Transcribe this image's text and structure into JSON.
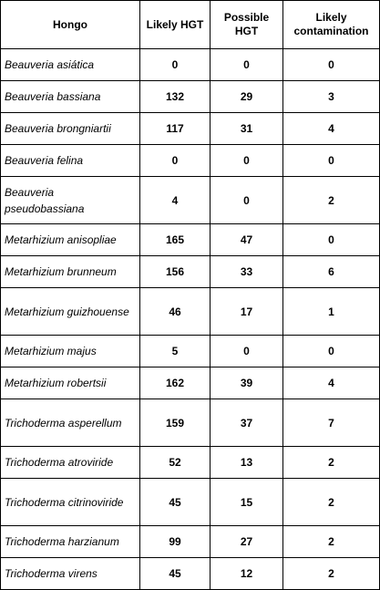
{
  "table": {
    "headers": [
      "Hongo",
      "Likely HGT",
      "Possible HGT",
      "Likely contamination"
    ],
    "rows": [
      {
        "name": "Beauveria asiática",
        "likely": "0",
        "possible": "0",
        "contamination": "0"
      },
      {
        "name": "Beauveria bassiana",
        "likely": "132",
        "possible": "29",
        "contamination": "3"
      },
      {
        "name": "Beauveria brongniartii",
        "likely": "117",
        "possible": "31",
        "contamination": "4"
      },
      {
        "name": "Beauveria felina",
        "likely": "0",
        "possible": "0",
        "contamination": "0"
      },
      {
        "name": "Beauveria pseudobassiana",
        "likely": "4",
        "possible": "0",
        "contamination": "2"
      },
      {
        "name": "Metarhizium anisopliae",
        "likely": "165",
        "possible": "47",
        "contamination": "0"
      },
      {
        "name": "Metarhizium brunneum",
        "likely": "156",
        "possible": "33",
        "contamination": "6"
      },
      {
        "name": "Metarhizium guizhouense",
        "likely": "46",
        "possible": "17",
        "contamination": "1"
      },
      {
        "name": "Metarhizium majus",
        "likely": "5",
        "possible": "0",
        "contamination": "0"
      },
      {
        "name": "Metarhizium robertsii",
        "likely": "162",
        "possible": "39",
        "contamination": "4"
      },
      {
        "name": "Trichoderma asperellum",
        "likely": "159",
        "possible": "37",
        "contamination": "7"
      },
      {
        "name": "Trichoderma atroviride",
        "likely": "52",
        "possible": "13",
        "contamination": "2"
      },
      {
        "name": "Trichoderma citrinoviride",
        "likely": "45",
        "possible": "15",
        "contamination": "2"
      },
      {
        "name": "Trichoderma harzianum",
        "likely": "99",
        "possible": "27",
        "contamination": "2"
      },
      {
        "name": "Trichoderma virens",
        "likely": "45",
        "possible": "12",
        "contamination": "2"
      }
    ]
  }
}
